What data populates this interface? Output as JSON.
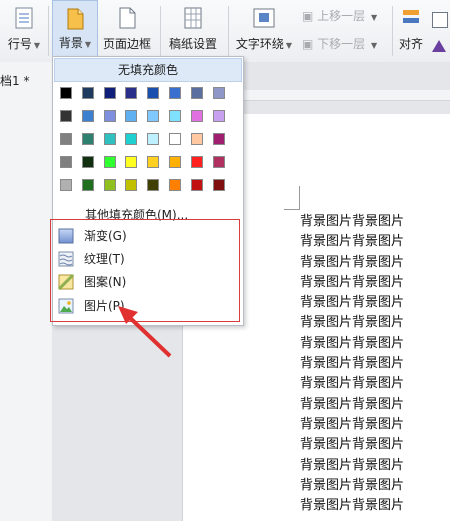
{
  "ribbon": {
    "line_number_label": "行号",
    "background_label": "背景",
    "page_border_label": "页面边框",
    "paper_setting_label": "稿纸设置",
    "text_wrap_label": "文字环绕",
    "move_up_label": "上移一层",
    "move_down_label": "下移一层",
    "align_label": "对齐"
  },
  "document": {
    "tab_name": "档1 *",
    "background_lines": [
      "背景图片背景图片",
      "背景图片背景图片",
      "背景图片背景图片",
      "背景图片背景图片",
      "背景图片背景图片",
      "背景图片背景图片",
      "背景图片背景图片",
      "背景图片背景图片",
      "背景图片背景图片",
      "背景图片背景图片",
      "背景图片背景图片",
      "背景图片背景图片",
      "背景图片背景图片",
      "背景图片背景图片",
      "背景图片背景图片"
    ]
  },
  "dropdown": {
    "no_fill": "无填充颜色",
    "color_rows": [
      [
        "#000000",
        "#1f3a5f",
        "#10207a",
        "#2a2f8c",
        "#1a4fb0",
        "#3a6fd0",
        "#5a6fa0",
        "#8f97c8"
      ],
      [
        "#333333",
        "#3a7fd0",
        "#7f8fe0",
        "#5fb0f0",
        "#7fc8ff",
        "#7fe0ff",
        "#e070e0",
        "#c8a0f0"
      ],
      [
        "#808080",
        "#2f7f6f",
        "#30c0c0",
        "#20d0d0",
        "#bff0ff",
        "#ffffff",
        "#ffc8a0",
        "#a0206f"
      ],
      [
        "#7f7f7f",
        "#103010",
        "#30ff30",
        "#ffff20",
        "#ffd020",
        "#ffb000",
        "#ff2020",
        "#b03060"
      ],
      [
        "#b0b0b0",
        "#1f6f1f",
        "#90c020",
        "#c0c000",
        "#404000",
        "#ff8000",
        "#c01010",
        "#801010"
      ]
    ],
    "more_colors": "其他填充颜色(M)...",
    "items": [
      {
        "label": "渐变(G)",
        "icon": "gradient-icon"
      },
      {
        "label": "纹理(T)",
        "icon": "texture-icon"
      },
      {
        "label": "图案(N)",
        "icon": "pattern-icon"
      },
      {
        "label": "图片(P)",
        "icon": "picture-icon"
      }
    ]
  },
  "colors": {
    "highlight_border": "#d93c3c",
    "arrow": "#e03030"
  }
}
